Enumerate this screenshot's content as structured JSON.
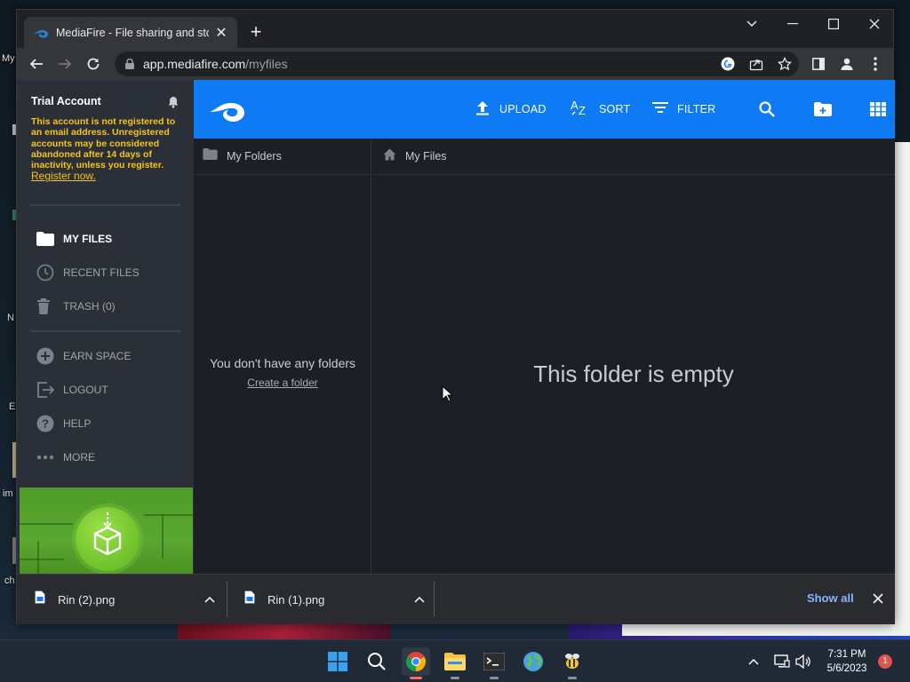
{
  "desktop": {
    "labels": [
      "My",
      "N",
      "E",
      "im",
      "ch"
    ]
  },
  "browser": {
    "tab": {
      "title": "MediaFire - File sharing and storage",
      "favicon": "mediafire-logo-icon"
    },
    "address": {
      "host": "app.mediafire.com",
      "path": "/myfiles"
    }
  },
  "sidebar": {
    "account_title": "Trial Account",
    "warning": "This account is not registered to an email address. Unregistered accounts may be considered abandoned after 14 days of inactivity, unless you register.",
    "register_link": "Register now.",
    "items": [
      {
        "label": "MY FILES",
        "icon": "folder-icon",
        "active": true
      },
      {
        "label": "RECENT FILES",
        "icon": "clock-icon"
      },
      {
        "label": "TRASH (0)",
        "icon": "trash-icon"
      },
      {
        "label": "EARN SPACE",
        "icon": "plus-circle-icon"
      },
      {
        "label": "LOGOUT",
        "icon": "logout-icon"
      },
      {
        "label": "HELP",
        "icon": "help-icon"
      },
      {
        "label": "MORE",
        "icon": "more-dots-icon"
      }
    ]
  },
  "header": {
    "upload": "UPLOAD",
    "sort": "SORT",
    "filter": "FILTER"
  },
  "folders_pane": {
    "title": "My Folders",
    "empty_text": "You don't have any folders",
    "create_link": "Create a folder"
  },
  "files_pane": {
    "title": "My Files",
    "empty_text": "This folder is empty"
  },
  "downloads": {
    "items": [
      {
        "name": "Rin (2).png"
      },
      {
        "name": "Rin (1).png"
      }
    ],
    "show_all": "Show all"
  },
  "taskbar": {
    "time": "7:31 PM",
    "date": "5/6/2023",
    "notification_count": "1"
  },
  "colors": {
    "brand_blue": "#0e7bf4",
    "warning_yellow": "#f5c518",
    "sidebar_bg": "#2b2f37"
  }
}
